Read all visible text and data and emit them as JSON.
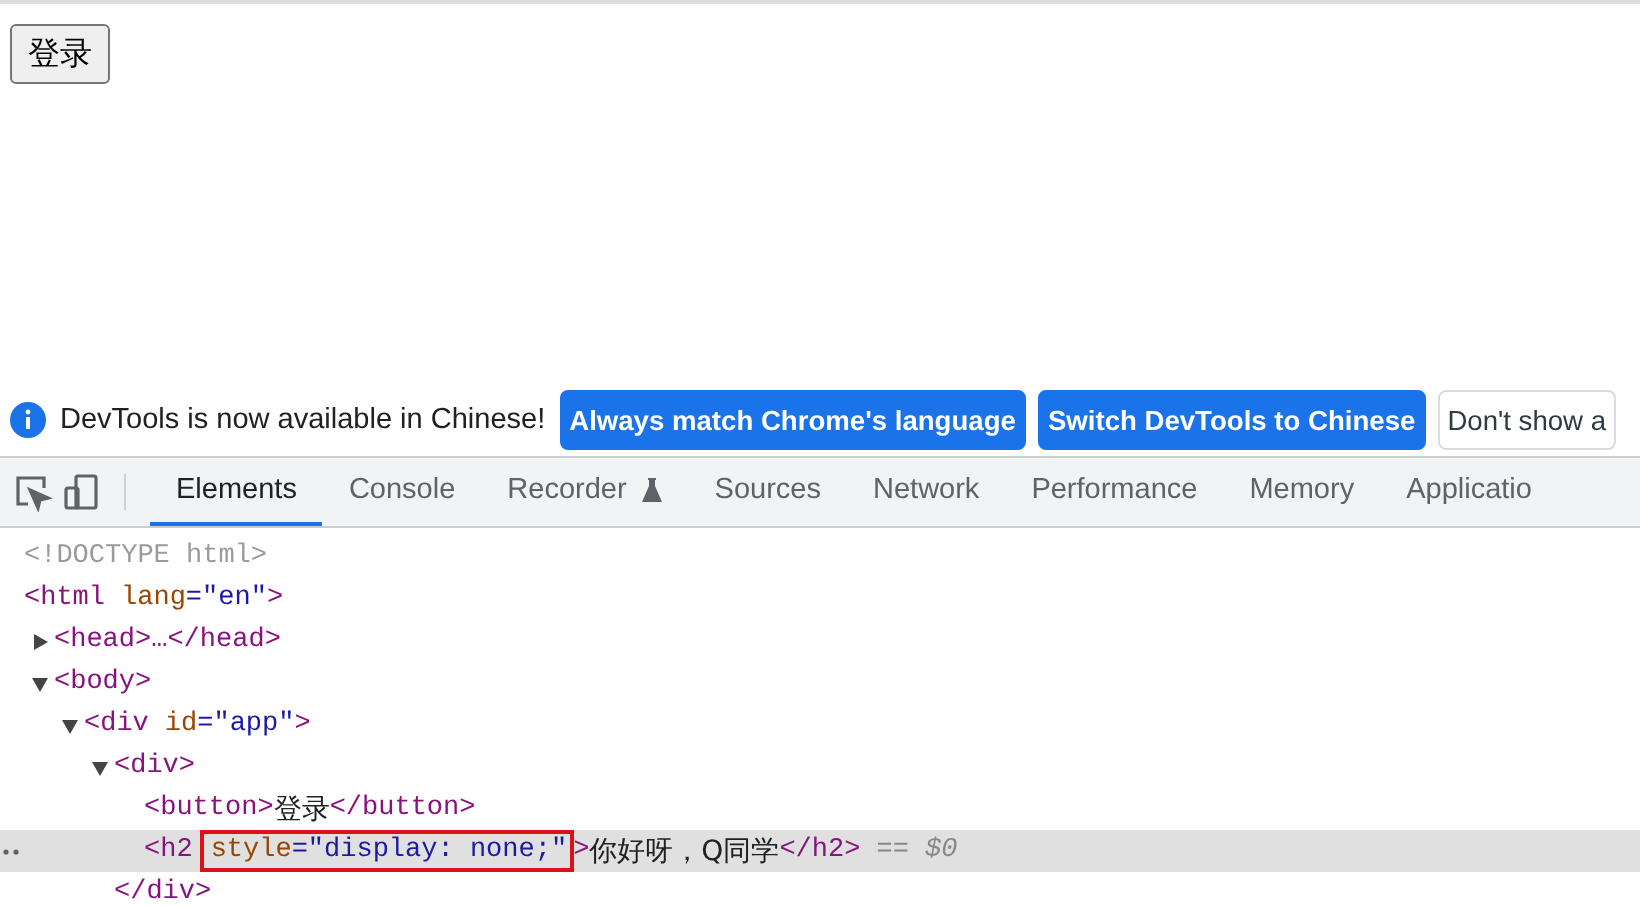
{
  "page": {
    "button": "登录"
  },
  "infobar": {
    "message": "DevTools is now available in Chinese!",
    "buttons": [
      {
        "label": "Always match Chrome's language",
        "kind": "primary"
      },
      {
        "label": "Switch DevTools to Chinese",
        "kind": "primary"
      },
      {
        "label": "Don't show a",
        "kind": "secondary"
      }
    ]
  },
  "tabs": [
    {
      "label": "Elements",
      "selected": true
    },
    {
      "label": "Console",
      "selected": false
    },
    {
      "label": "Recorder",
      "selected": false,
      "experimental": true
    },
    {
      "label": "Sources",
      "selected": false
    },
    {
      "label": "Network",
      "selected": false
    },
    {
      "label": "Performance",
      "selected": false
    },
    {
      "label": "Memory",
      "selected": false
    },
    {
      "label": "Applicatio",
      "selected": false
    }
  ],
  "dom_tree": [
    {
      "tokens": [
        {
          "kind": "doctype",
          "text": "<!DOCTYPE html>"
        }
      ],
      "selected": false
    },
    {
      "tokens": [
        {
          "kind": "tag",
          "text": "<html"
        },
        {
          "kind": "attr-name",
          "text": "lang"
        },
        {
          "kind": "punct",
          "text": "=\""
        },
        {
          "kind": "attr-value",
          "text": "en"
        },
        {
          "kind": "punct",
          "text": "\""
        },
        {
          "kind": "tag",
          "text": ">"
        }
      ],
      "selected": false,
      "children": [
        {
          "tokens": [
            {
              "kind": "tag",
              "text": "<head>…</head>"
            }
          ],
          "expanded": false,
          "selected": false
        },
        {
          "tokens": [
            {
              "kind": "tag",
              "text": "<body>"
            }
          ],
          "expanded": true,
          "selected": false,
          "children": [
            {
              "tokens": [
                {
                  "kind": "tag",
                  "text": "<div"
                },
                {
                  "kind": "attr-name",
                  "text": "id"
                },
                {
                  "kind": "punct",
                  "text": "=\""
                },
                {
                  "kind": "attr-value",
                  "text": "app"
                },
                {
                  "kind": "punct",
                  "text": "\""
                },
                {
                  "kind": "tag",
                  "text": ">"
                }
              ],
              "expanded": true,
              "selected": false,
              "children": [
                {
                  "tokens": [
                    {
                      "kind": "tag",
                      "text": "<div>"
                    }
                  ],
                  "expanded": true,
                  "selected": false,
                  "children": [
                    {
                      "tokens": [
                        {
                          "kind": "tag",
                          "text": "<button>"
                        },
                        {
                          "kind": "text",
                          "text": "登录"
                        },
                        {
                          "kind": "tag",
                          "text": "</button>"
                        }
                      ],
                      "selected": false
                    },
                    {
                      "tokens": [
                        {
                          "kind": "tag",
                          "text": "<h2"
                        },
                        {
                          "kind": "attr-name",
                          "text": "style",
                          "boxed": true
                        },
                        {
                          "kind": "punct",
                          "text": "=\"",
                          "boxed": true
                        },
                        {
                          "kind": "attr-value",
                          "text": "display: none;",
                          "boxed": true
                        },
                        {
                          "kind": "punct",
                          "text": "\"",
                          "boxed": true
                        },
                        {
                          "kind": "tag",
                          "text": ">"
                        },
                        {
                          "kind": "text",
                          "text": "你好呀，Q同学"
                        },
                        {
                          "kind": "tag",
                          "text": "</h2>"
                        },
                        {
                          "kind": "ref",
                          "text": "== $0"
                        }
                      ],
                      "selected": true
                    }
                  ],
                  "closing": [
                    {
                      "kind": "tag",
                      "text": "</div>"
                    }
                  ]
                }
              ]
            }
          ]
        }
      ]
    }
  ]
}
